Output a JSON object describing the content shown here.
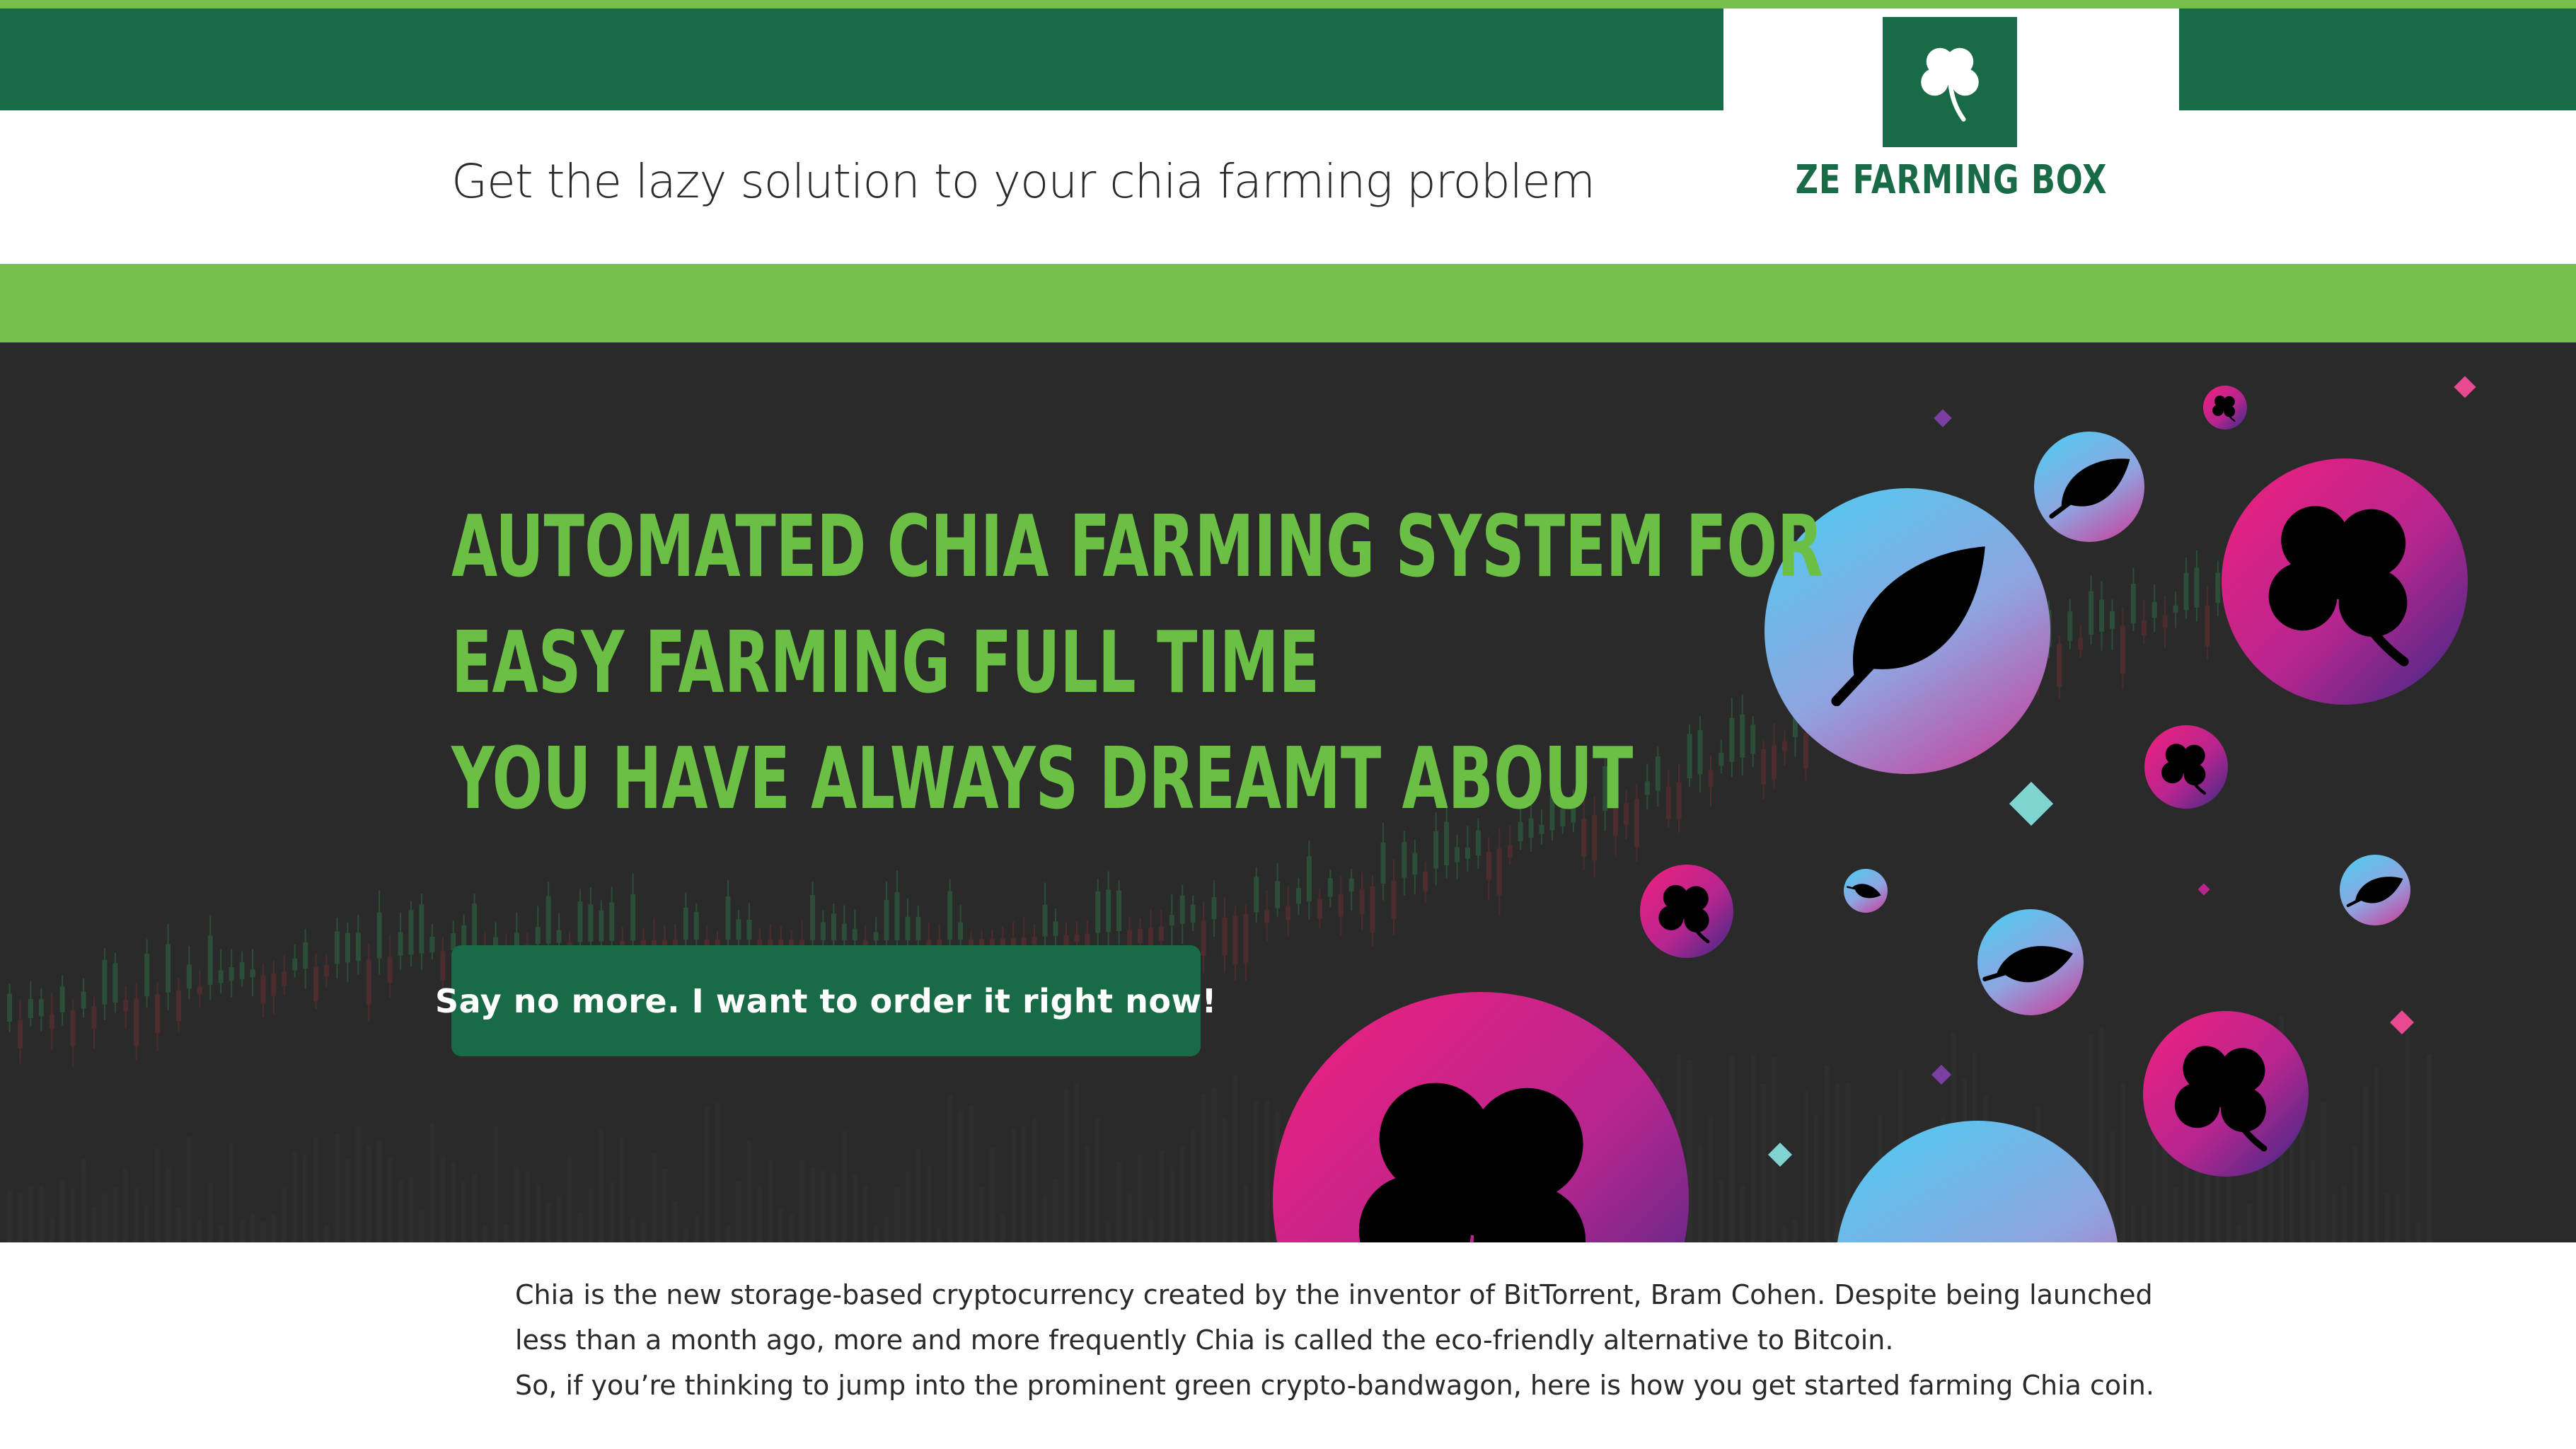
{
  "header": {
    "tagline": "Get the lazy solution to your chia farming problem",
    "brand_name": "ZE FARMING BOX",
    "logo_icon": "clover-icon"
  },
  "hero": {
    "headline_lines": [
      "AUTOMATED CHIA FARMING SYSTEM FOR",
      "EASY FARMING FULL TIME",
      "YOU HAVE ALWAYS DREAMT ABOUT"
    ],
    "cta_label": "Say no more. I want to order it right now!",
    "decor_icons": [
      "leaf-icon",
      "clover-icon"
    ]
  },
  "intro": {
    "paragraph_1": "Chia is the new storage-based cryptocurrency created by the inventor of BitTorrent, Bram Cohen. Despite being launched less than a month ago, more and more frequently Chia is called the eco-friendly alternative to Bitcoin.",
    "paragraph_2": "So, if you’re thinking to jump into the prominent green crypto-bandwagon, here is how you get started farming Chia coin."
  },
  "colors": {
    "dark_green": "#196b47",
    "light_green": "#75bf4a",
    "headline_green": "#6cbf45",
    "hero_background": "#2a2a2a",
    "gradient_pink": "#f0207d",
    "gradient_blue": "#5cc7ee",
    "gradient_purple": "#4a2b8c"
  }
}
